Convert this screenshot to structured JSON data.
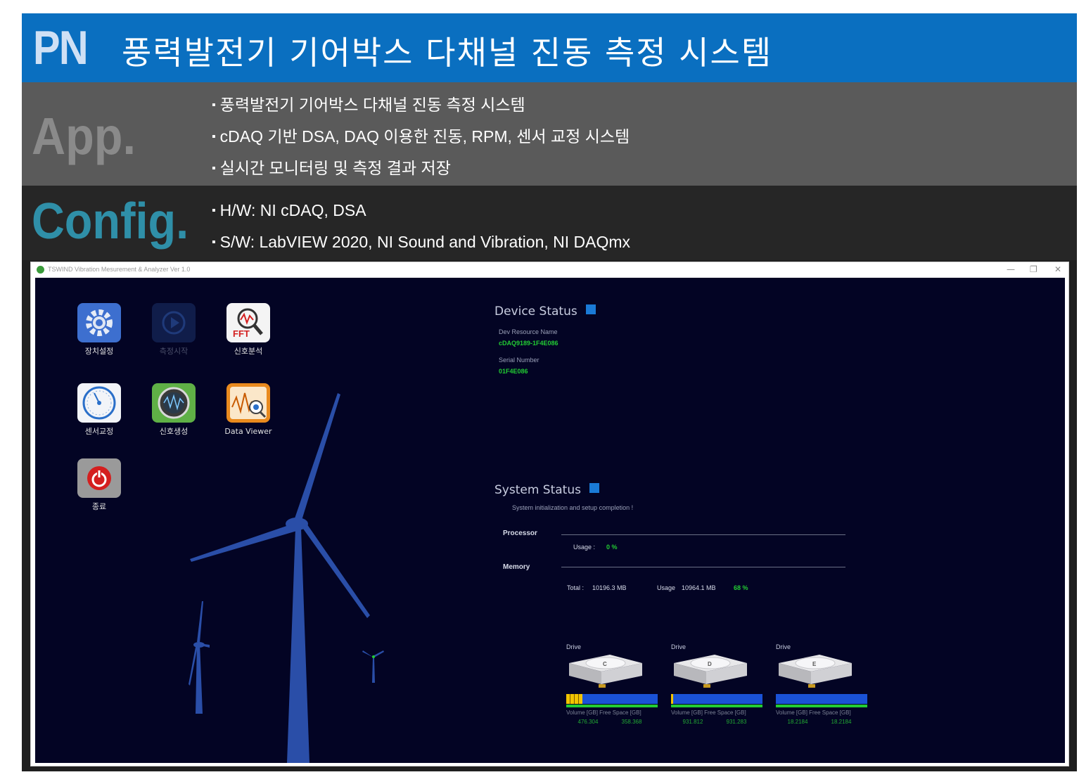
{
  "header": {
    "logo": "PN",
    "title": "풍력발전기 기어박스 다채널 진동 측정 시스템"
  },
  "app": {
    "label": "App.",
    "bullets": [
      "풍력발전기 기어박스 다채널 진동 측정 시스템",
      "cDAQ 기반 DSA, DAQ 이용한 진동, RPM, 센서 교정 시스템",
      "실시간 모니터링 및 측정 결과 저장"
    ]
  },
  "config": {
    "label": "Config.",
    "bullets": [
      "H/W: NI cDAQ, DSA",
      "S/W: LabVIEW 2020, NI Sound and Vibration, NI DAQmx"
    ]
  },
  "window": {
    "title": "TSWIND Vibration Mesurement & Analyzer Ver 1.0",
    "controls": {
      "minimize": "—",
      "restore": "❐",
      "close": "✕"
    }
  },
  "menu": {
    "device_setup": "장치설정",
    "start_measure": "측정시작",
    "signal_analysis": "신호분석",
    "fft_text": "FFT",
    "sensor_calibration": "센서교정",
    "signal_generation": "신호생성",
    "data_viewer": "Data Viewer",
    "exit": "종료"
  },
  "device_status": {
    "title": "Device Status",
    "resource_label": "Dev Resource Name",
    "resource_value": "cDAQ9189-1F4E086",
    "serial_label": "Serial Number",
    "serial_value": "01F4E086"
  },
  "system_status": {
    "title": "System Status",
    "message": "System initialization and setup completion !",
    "processor_label": "Processor",
    "usage_label": "Usage :",
    "cpu_usage": "0 %",
    "memory_label": "Memory",
    "total_label": "Total :",
    "total_value": "10196.3 MB",
    "mem_usage_label": "Usage",
    "mem_usage_value": "10964.1 MB",
    "mem_percent": "68 %"
  },
  "drives": [
    {
      "label": "Drive",
      "letter": "C",
      "volume_header": "Volume [GB] Free Space [GB]",
      "volume": "476.304",
      "free": "358.368",
      "used_fraction": 0.18
    },
    {
      "label": "Drive",
      "letter": "D",
      "volume_header": "Volume [GB] Free Space [GB]",
      "volume": "931.812",
      "free": "931.283",
      "used_fraction": 0.02
    },
    {
      "label": "Drive",
      "letter": "E",
      "volume_header": "Volume [GB] Free Space [GB]",
      "volume": "18.2184",
      "free": "18.2184",
      "used_fraction": 0.0
    }
  ],
  "colors": {
    "header_blue": "#0a6fc0",
    "app_band": "#5a5a5a",
    "config_band": "#262626",
    "client_bg": "#030424",
    "status_square": "#1a7ad6",
    "value_green": "#22cc33",
    "turbine_blue": "#2a4ea8"
  }
}
